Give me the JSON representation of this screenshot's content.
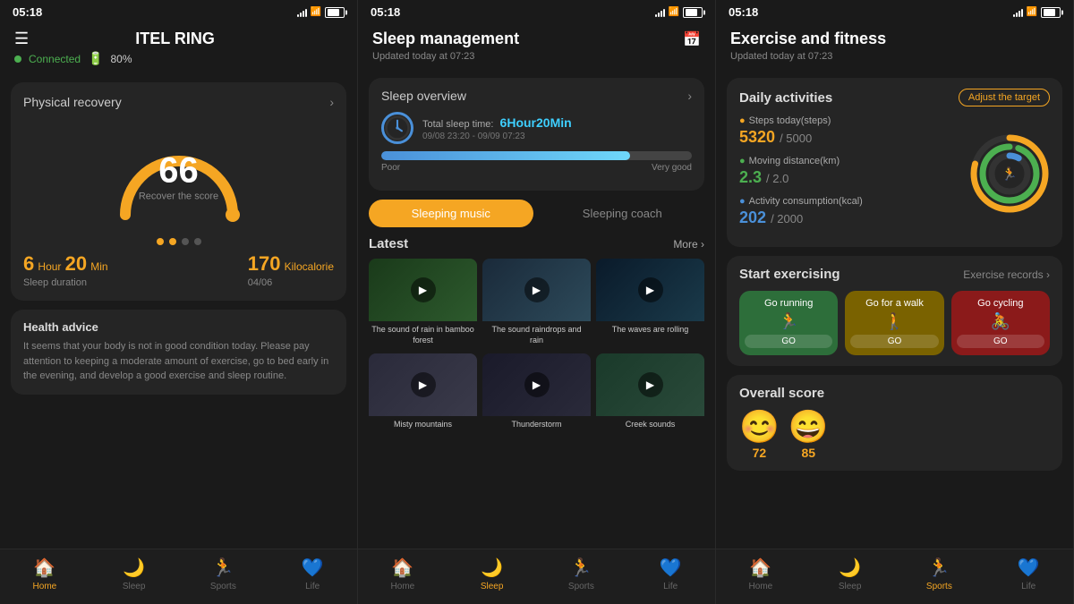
{
  "panels": [
    {
      "id": "home",
      "statusTime": "05:18",
      "batteryPct": 80,
      "headerTitle": "ITEL RING",
      "connectedText": "Connected",
      "batteryText": "80%",
      "recoveryCard": {
        "title": "Physical recovery",
        "score": "66",
        "scoreLabel": "Recover the score",
        "dots": [
          true,
          true,
          false,
          false
        ]
      },
      "stats": {
        "hours": "6",
        "hoursUnit": "Hour",
        "mins": "20",
        "minsUnit": "Min",
        "calories": "170",
        "caloriesUnit": "Kilocalorie",
        "sleepLabel": "Sleep duration",
        "dateLabel": "04/06"
      },
      "healthCard": {
        "title": "Health advice",
        "text": "It seems that your body is not in good condition today. Please pay attention to keeping a moderate amount of exercise, go to bed early in the evening, and develop a good exercise and sleep routine."
      },
      "nav": {
        "items": [
          {
            "icon": "🏠",
            "label": "Home",
            "active": true
          },
          {
            "icon": "🌙",
            "label": "Sleep",
            "active": false
          },
          {
            "icon": "🏃",
            "label": "Sports",
            "active": false
          },
          {
            "icon": "💙",
            "label": "Life",
            "active": false
          }
        ]
      }
    },
    {
      "id": "sleep",
      "statusTime": "05:18",
      "batteryPct": 80,
      "headerTitle": "Sleep management",
      "headerSubtitle": "Updated today at 07:23",
      "sleepOverview": {
        "title": "Sleep overview",
        "totalLabel": "Total sleep time:",
        "totalValue": "6Hour20Min",
        "timeRange": "09/08 23:20 - 09/09 07:23",
        "poorLabel": "Poor",
        "veryGoodLabel": "Very good"
      },
      "tabs": [
        {
          "label": "Sleeping music",
          "active": true
        },
        {
          "label": "Sleeping coach",
          "active": false
        }
      ],
      "latest": {
        "title": "Latest",
        "moreLabel": "More",
        "items": [
          {
            "bg": "forest",
            "label": "The sound of rain in bamboo forest"
          },
          {
            "bg": "rain",
            "label": "The sound raindrops and rain"
          },
          {
            "bg": "waves",
            "label": "The waves are rolling"
          },
          {
            "bg": "mist",
            "label": "Misty mountains"
          },
          {
            "bg": "storm",
            "label": "Thunderstorm"
          },
          {
            "bg": "creek",
            "label": "Creek sounds"
          }
        ]
      },
      "nav": {
        "items": [
          {
            "icon": "🏠",
            "label": "Home",
            "active": false
          },
          {
            "icon": "🌙",
            "label": "Sleep",
            "active": true
          },
          {
            "icon": "🏃",
            "label": "Sports",
            "active": false
          },
          {
            "icon": "💙",
            "label": "Life",
            "active": false
          }
        ]
      }
    },
    {
      "id": "exercise",
      "statusTime": "05:18",
      "batteryPct": 80,
      "headerTitle": "Exercise and fitness",
      "headerSubtitle": "Updated today at 07:23",
      "dailyActivities": {
        "title": "Daily activities",
        "adjustLabel": "Adjust the target",
        "steps": {
          "label": "Steps today(steps)",
          "value": "5320",
          "total": "/ 5000"
        },
        "distance": {
          "label": "Moving distance(km)",
          "value": "2.3",
          "total": "/ 2.0"
        },
        "calories": {
          "label": "Activity consumption(kcal)",
          "value": "202",
          "total": "/ 2000"
        }
      },
      "exercise": {
        "title": "Start exercising",
        "recordsLabel": "Exercise records",
        "buttons": [
          {
            "label": "Go running",
            "icon": "🏃",
            "color": "green"
          },
          {
            "label": "Go for a walk",
            "icon": "🚶",
            "color": "yellow"
          },
          {
            "label": "Go cycling",
            "icon": "🚴",
            "color": "red"
          }
        ]
      },
      "overall": {
        "title": "Overall score",
        "faces": [
          {
            "emoji": "😊",
            "score": "72"
          },
          {
            "emoji": "😄",
            "score": "85"
          }
        ]
      },
      "nav": {
        "items": [
          {
            "icon": "🏠",
            "label": "Home",
            "active": false
          },
          {
            "icon": "🌙",
            "label": "Sleep",
            "active": false
          },
          {
            "icon": "🏃",
            "label": "Sports",
            "active": true
          },
          {
            "icon": "💙",
            "label": "Life",
            "active": false
          }
        ]
      }
    }
  ]
}
